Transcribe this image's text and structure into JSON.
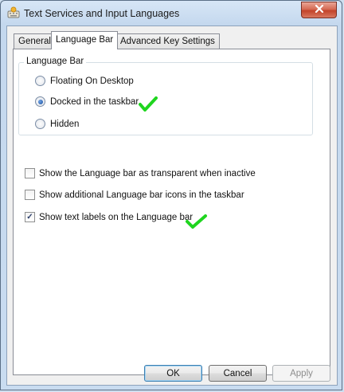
{
  "window": {
    "title": "Text Services and Input Languages"
  },
  "tabs": [
    {
      "label": "General"
    },
    {
      "label": "Language Bar",
      "selected": true
    },
    {
      "label": "Advanced Key Settings"
    }
  ],
  "language_bar_group": {
    "label": "Language Bar",
    "options": [
      {
        "label": "Floating On Desktop",
        "selected": false
      },
      {
        "label": "Docked in the taskbar",
        "selected": true
      },
      {
        "label": "Hidden",
        "selected": false
      }
    ]
  },
  "checkboxes": [
    {
      "label": "Show the Language bar as transparent when inactive",
      "checked": false
    },
    {
      "label": "Show additional Language bar icons in the taskbar",
      "checked": false
    },
    {
      "label": "Show text labels on the Language bar",
      "checked": true
    }
  ],
  "buttons": {
    "ok": "OK",
    "cancel": "Cancel",
    "apply": "Apply"
  },
  "colors": {
    "annotation_tick": "#1fd51f",
    "close_button": "#c94a33"
  }
}
